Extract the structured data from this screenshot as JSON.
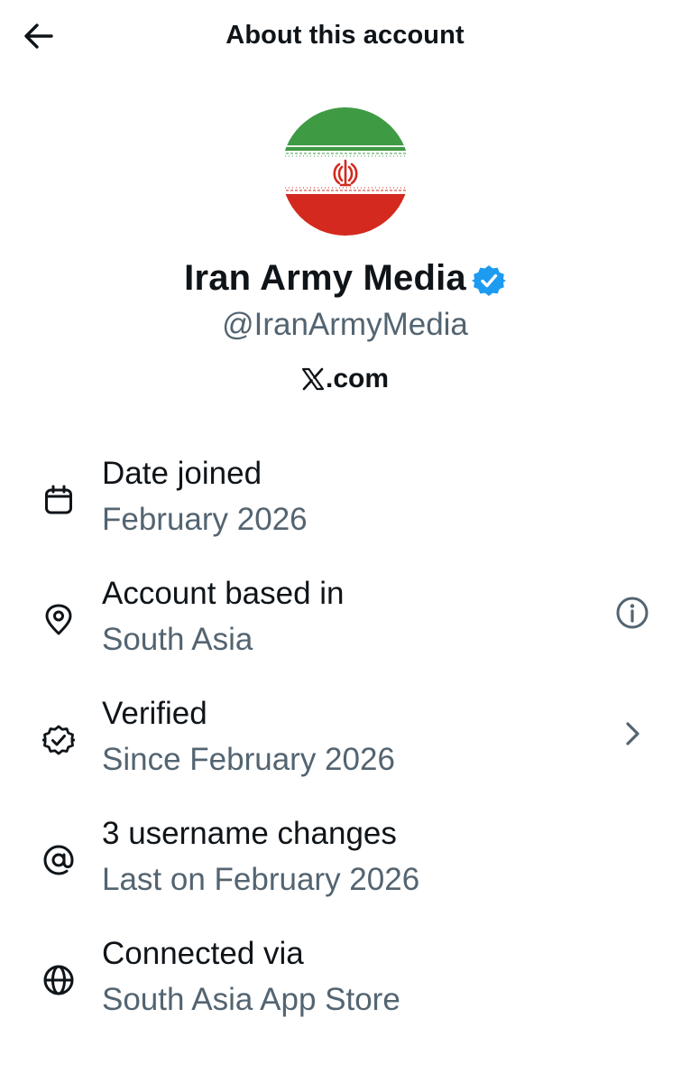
{
  "header": {
    "back_icon": "arrow-left-icon",
    "title": "About this account"
  },
  "profile": {
    "avatar": "iran-flag-avatar",
    "name": "Iran Army Media",
    "verified_badge": "verified-badge-icon",
    "handle": "@IranArmyMedia",
    "website_logo": "X",
    "website": ".com"
  },
  "rows": [
    {
      "icon": "calendar-icon",
      "title": "Date joined",
      "subtitle": "February 2026",
      "trailing": null
    },
    {
      "icon": "location-pin-icon",
      "title": "Account based in",
      "subtitle": "South Asia",
      "trailing": "info-icon"
    },
    {
      "icon": "verified-seal-icon",
      "title": "Verified",
      "subtitle": "Since February 2026",
      "trailing": "chevron-right-icon"
    },
    {
      "icon": "at-sign-icon",
      "title": "3 username changes",
      "subtitle": "Last on February 2026",
      "trailing": null
    },
    {
      "icon": "globe-icon",
      "title": "Connected via",
      "subtitle": "South Asia App Store",
      "trailing": null
    }
  ],
  "colors": {
    "text_primary": "#0f1419",
    "text_secondary": "#536471",
    "verified_blue": "#1d9bf0",
    "flag_green": "#239f40",
    "flag_white": "#ffffff",
    "flag_red": "#da0000"
  }
}
